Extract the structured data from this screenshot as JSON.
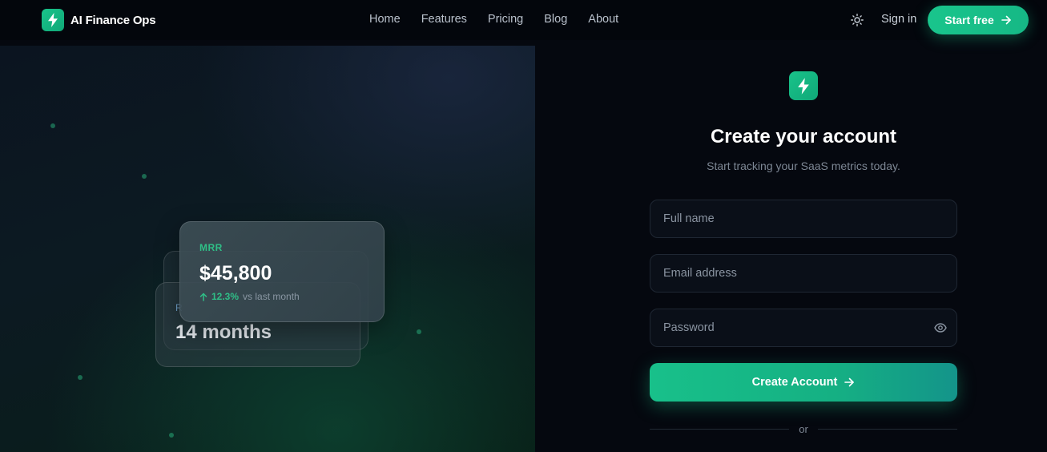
{
  "nav": {
    "brand": "AI Finance Ops",
    "links": [
      "Home",
      "Features",
      "Pricing",
      "Blog",
      "About"
    ],
    "signin": "Sign in",
    "cta": "Start free"
  },
  "hero": {
    "front_card": {
      "label": "MRR",
      "value": "$45,800",
      "change": "12.3%",
      "change_suffix": "vs last month"
    },
    "back_card": {
      "label_partial": "R",
      "value": "14 months"
    }
  },
  "form": {
    "title": "Create your account",
    "subtitle": "Start tracking your SaaS metrics today.",
    "fields": {
      "full_name": {
        "placeholder": "Full name",
        "value": ""
      },
      "email": {
        "placeholder": "Email address",
        "value": ""
      },
      "password": {
        "placeholder": "Password",
        "value": ""
      }
    },
    "submit": "Create Account",
    "divider": "or"
  },
  "icons": {
    "logo": "lightning-bolt-icon",
    "theme": "sun-icon",
    "cta_arrow": "arrow-right-icon",
    "password_toggle": "eye-icon",
    "trend": "arrow-up-icon"
  },
  "colors": {
    "accent": "#19c58c",
    "background": "#05080f",
    "field_bg": "#0a0f18",
    "field_border": "#1f2733",
    "muted_text": "#7d8794"
  }
}
